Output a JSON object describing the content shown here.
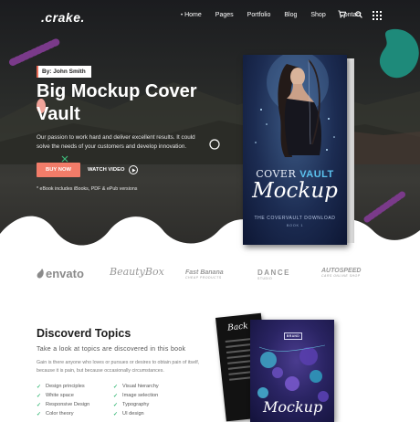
{
  "nav": {
    "logo": ".crake.",
    "items": [
      {
        "label": "Home",
        "active": true
      },
      {
        "label": "Pages"
      },
      {
        "label": "Portfolio"
      },
      {
        "label": "Blog"
      },
      {
        "label": "Shop"
      },
      {
        "label": "Contact"
      }
    ],
    "icons": [
      "cart-icon",
      "search-icon",
      "grid-menu-icon"
    ]
  },
  "hero": {
    "author": "By: John Smith",
    "title": "Big Mockup Cover Vault",
    "description": "Our passion to work hard and deliver excellent results. It could solve the needs of your customers and develop innovation.",
    "buy_label": "BUY NOW",
    "watch_label": "WATCH VIDEO",
    "note": "* eBook includes iBooks, PDF & ePub versions",
    "accent_color": "#f27c69"
  },
  "book": {
    "title_line1": "COVER",
    "title_line1_accent": "VAULT",
    "title_line2": "Mockup",
    "subtitle": "THE COVERVAULT DOWNLOAD",
    "subtitle2": "BOOK 1"
  },
  "brands": {
    "envato": "envato",
    "beauty": "BeautyBox",
    "fast": "Fast Banana",
    "fast_sub": "CHEAP PRODUCTS",
    "dance": "DANCE",
    "dance_sub": "STUDIO",
    "auto": "AUTOSPEED",
    "auto_sub": "CARS ONLINE SHOP"
  },
  "topics": {
    "title": "Discoverd Topics",
    "subtitle": "Take a look at topics are discovered in this book",
    "description": "Gain is there anyone who loves or pursues or desires to obtain pain of itself, because it is pain, but because occasionally circumstances.",
    "left": [
      "Design principles",
      "White space",
      "Responsive Design",
      "Color theory"
    ],
    "right": [
      "Visual hierarchy",
      "Image selection",
      "Typography",
      "UI design"
    ],
    "check_color": "#3cb97a"
  },
  "book2": {
    "back_title": "Back",
    "tag": "BRAND",
    "front_title": "Mockup"
  }
}
